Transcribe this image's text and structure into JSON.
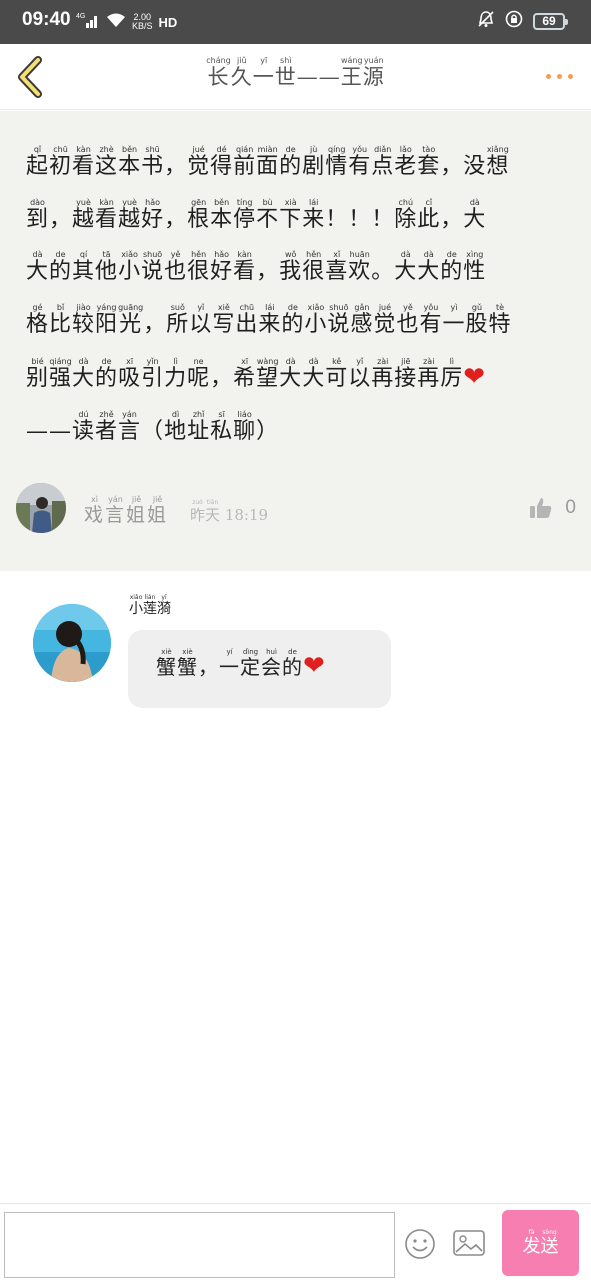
{
  "status_bar": {
    "time": "09:40",
    "net_type": "4G",
    "speed": "2.00",
    "speed_unit": "KB/S",
    "hd": "HD",
    "battery": "69"
  },
  "header": {
    "title_chars": [
      {
        "c": "长",
        "p": "cháng"
      },
      {
        "c": "久",
        "p": "jiǔ"
      },
      {
        "c": "一",
        "p": "yī"
      },
      {
        "c": "世",
        "p": "shì"
      },
      {
        "c": "—",
        "p": ""
      },
      {
        "c": "—",
        "p": ""
      },
      {
        "c": "王",
        "p": "wáng"
      },
      {
        "c": "源",
        "p": "yuán"
      }
    ]
  },
  "comment": {
    "lines": [
      [
        {
          "c": "起",
          "p": "qǐ"
        },
        {
          "c": "初",
          "p": "chū"
        },
        {
          "c": "看",
          "p": "kàn"
        },
        {
          "c": "这",
          "p": "zhè"
        },
        {
          "c": "本",
          "p": "běn"
        },
        {
          "c": "书",
          "p": "shū"
        },
        {
          "c": "，",
          "p": ""
        },
        {
          "c": "觉",
          "p": "jué"
        },
        {
          "c": "得",
          "p": "dé"
        },
        {
          "c": "前",
          "p": "qián"
        },
        {
          "c": "面",
          "p": "miàn"
        },
        {
          "c": "的",
          "p": "de"
        },
        {
          "c": "剧",
          "p": "jù"
        },
        {
          "c": "情",
          "p": "qíng"
        },
        {
          "c": "有",
          "p": "yǒu"
        },
        {
          "c": "点",
          "p": "diǎn"
        },
        {
          "c": "老",
          "p": "lǎo"
        },
        {
          "c": "套",
          "p": "tào"
        },
        {
          "c": "，",
          "p": ""
        },
        {
          "c": "没",
          "p": ""
        },
        {
          "c": "想",
          "p": "xiǎng"
        }
      ],
      [
        {
          "c": "到",
          "p": "dào"
        },
        {
          "c": "，",
          "p": ""
        },
        {
          "c": "越",
          "p": "yuè"
        },
        {
          "c": "看",
          "p": "kàn"
        },
        {
          "c": "越",
          "p": "yuè"
        },
        {
          "c": "好",
          "p": "hǎo"
        },
        {
          "c": "，",
          "p": ""
        },
        {
          "c": "根",
          "p": "gēn"
        },
        {
          "c": "本",
          "p": "běn"
        },
        {
          "c": "停",
          "p": "tíng"
        },
        {
          "c": "不",
          "p": "bù"
        },
        {
          "c": "下",
          "p": "xià"
        },
        {
          "c": "来",
          "p": "lái"
        },
        {
          "c": "！",
          "p": ""
        },
        {
          "c": "！",
          "p": ""
        },
        {
          "c": "！",
          "p": ""
        },
        {
          "c": "除",
          "p": "chú"
        },
        {
          "c": "此",
          "p": "cǐ"
        },
        {
          "c": "，",
          "p": ""
        },
        {
          "c": "大",
          "p": "dà"
        }
      ],
      [
        {
          "c": "大",
          "p": "dà"
        },
        {
          "c": "的",
          "p": "de"
        },
        {
          "c": "其",
          "p": "qí"
        },
        {
          "c": "他",
          "p": "tā"
        },
        {
          "c": "小",
          "p": "xiǎo"
        },
        {
          "c": "说",
          "p": "shuō"
        },
        {
          "c": "也",
          "p": "yě"
        },
        {
          "c": "很",
          "p": "hěn"
        },
        {
          "c": "好",
          "p": "hǎo"
        },
        {
          "c": "看",
          "p": "kàn"
        },
        {
          "c": "，",
          "p": ""
        },
        {
          "c": "我",
          "p": "wǒ"
        },
        {
          "c": "很",
          "p": "hěn"
        },
        {
          "c": "喜",
          "p": "xǐ"
        },
        {
          "c": "欢",
          "p": "huān"
        },
        {
          "c": "。",
          "p": ""
        },
        {
          "c": "大",
          "p": "dà"
        },
        {
          "c": "大",
          "p": "dà"
        },
        {
          "c": "的",
          "p": "de"
        },
        {
          "c": "性",
          "p": "xìng"
        }
      ],
      [
        {
          "c": "格",
          "p": "gé"
        },
        {
          "c": "比",
          "p": "bǐ"
        },
        {
          "c": "较",
          "p": "jiào"
        },
        {
          "c": "阳",
          "p": "yáng"
        },
        {
          "c": "光",
          "p": "guāng"
        },
        {
          "c": "，",
          "p": ""
        },
        {
          "c": "所",
          "p": "suǒ"
        },
        {
          "c": "以",
          "p": "yǐ"
        },
        {
          "c": "写",
          "p": "xiě"
        },
        {
          "c": "出",
          "p": "chū"
        },
        {
          "c": "来",
          "p": "lái"
        },
        {
          "c": "的",
          "p": "de"
        },
        {
          "c": "小",
          "p": "xiǎo"
        },
        {
          "c": "说",
          "p": "shuō"
        },
        {
          "c": "感",
          "p": "gǎn"
        },
        {
          "c": "觉",
          "p": "jué"
        },
        {
          "c": "也",
          "p": "yě"
        },
        {
          "c": "有",
          "p": "yǒu"
        },
        {
          "c": "一",
          "p": "yì"
        },
        {
          "c": "股",
          "p": "gǔ"
        },
        {
          "c": "特",
          "p": "tè"
        }
      ],
      [
        {
          "c": "别",
          "p": "bié"
        },
        {
          "c": "强",
          "p": "qiáng"
        },
        {
          "c": "大",
          "p": "dà"
        },
        {
          "c": "的",
          "p": "de"
        },
        {
          "c": "吸",
          "p": "xī"
        },
        {
          "c": "引",
          "p": "yǐn"
        },
        {
          "c": "力",
          "p": "lì"
        },
        {
          "c": "呢",
          "p": "ne"
        },
        {
          "c": "，",
          "p": ""
        },
        {
          "c": "希",
          "p": "xī"
        },
        {
          "c": "望",
          "p": "wàng"
        },
        {
          "c": "大",
          "p": "dà"
        },
        {
          "c": "大",
          "p": "dà"
        },
        {
          "c": "可",
          "p": "kě"
        },
        {
          "c": "以",
          "p": "yǐ"
        },
        {
          "c": "再",
          "p": "zài"
        },
        {
          "c": "接",
          "p": "jiē"
        },
        {
          "c": "再",
          "p": "zài"
        },
        {
          "c": "厉",
          "p": "lì"
        },
        {
          "c": "❤",
          "p": "",
          "heart": true
        }
      ],
      [
        {
          "c": "—",
          "p": ""
        },
        {
          "c": "—",
          "p": ""
        },
        {
          "c": "读",
          "p": "dú"
        },
        {
          "c": "者",
          "p": "zhě"
        },
        {
          "c": "言",
          "p": "yán"
        },
        {
          "c": "（",
          "p": ""
        },
        {
          "c": "地",
          "p": "dì"
        },
        {
          "c": "址",
          "p": "zhǐ"
        },
        {
          "c": "私",
          "p": "sī"
        },
        {
          "c": "聊",
          "p": "liáo"
        },
        {
          "c": "）",
          "p": ""
        }
      ]
    ],
    "author_chars": [
      {
        "c": "戏",
        "p": "xì"
      },
      {
        "c": "言",
        "p": "yán"
      },
      {
        "c": "姐",
        "p": "jiě"
      },
      {
        "c": "姐",
        "p": "jiě"
      }
    ],
    "time_chars": [
      {
        "c": "昨",
        "p": "zuó"
      },
      {
        "c": "天",
        "p": "tiān"
      }
    ],
    "time_value": "18:19",
    "like_count": "0"
  },
  "reply": {
    "name_chars": [
      {
        "c": "小",
        "p": "xiǎo"
      },
      {
        "c": "莲",
        "p": "lián"
      },
      {
        "c": "漪",
        "p": "yī"
      }
    ],
    "text_chars": [
      {
        "c": "蟹",
        "p": "xiè"
      },
      {
        "c": "蟹",
        "p": "xiè"
      },
      {
        "c": "，",
        "p": ""
      },
      {
        "c": "一",
        "p": "yí"
      },
      {
        "c": "定",
        "p": "dìng"
      },
      {
        "c": "会",
        "p": "huì"
      },
      {
        "c": "的",
        "p": "de"
      },
      {
        "c": "❤",
        "p": "",
        "heart": true
      }
    ]
  },
  "bottom": {
    "input_value": "",
    "send_chars": [
      {
        "c": "发",
        "p": "fā"
      },
      {
        "c": "送",
        "p": "sòng"
      }
    ]
  },
  "colors": {
    "accent_orange": "#f39c57",
    "back_yellow": "#f5df73",
    "send_pink": "#f77eb0",
    "heart_red": "#e0201f"
  }
}
